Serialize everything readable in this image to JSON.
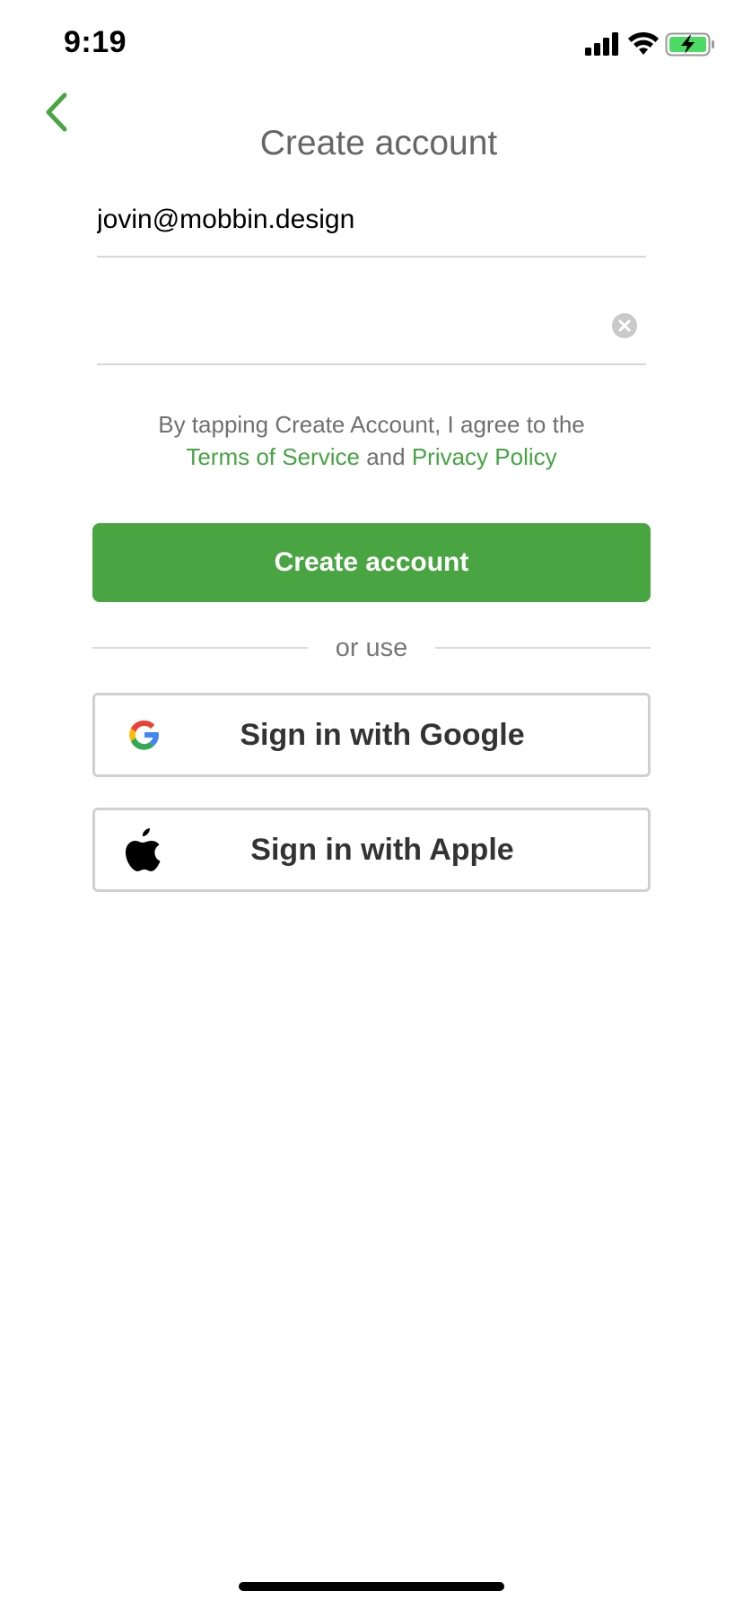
{
  "status_bar": {
    "time": "9:19"
  },
  "header": {
    "title": "Create account"
  },
  "form": {
    "email_value": "jovin@mobbin.design",
    "password_value": ""
  },
  "terms": {
    "prefix": "By tapping Create Account, I agree to the",
    "terms_link": "Terms of Service",
    "conjunction": "and",
    "privacy_link": "Privacy Policy"
  },
  "buttons": {
    "create_account": "Create account",
    "or_use": "or use",
    "google": "Sign in with Google",
    "apple": "Sign in with Apple"
  },
  "colors": {
    "accent": "#49a542",
    "link": "#47a344",
    "title": "#666666"
  },
  "icons": {
    "back": "chevron-left-icon",
    "clear": "clear-circle-icon",
    "google": "google-logo-icon",
    "apple": "apple-logo-icon"
  }
}
